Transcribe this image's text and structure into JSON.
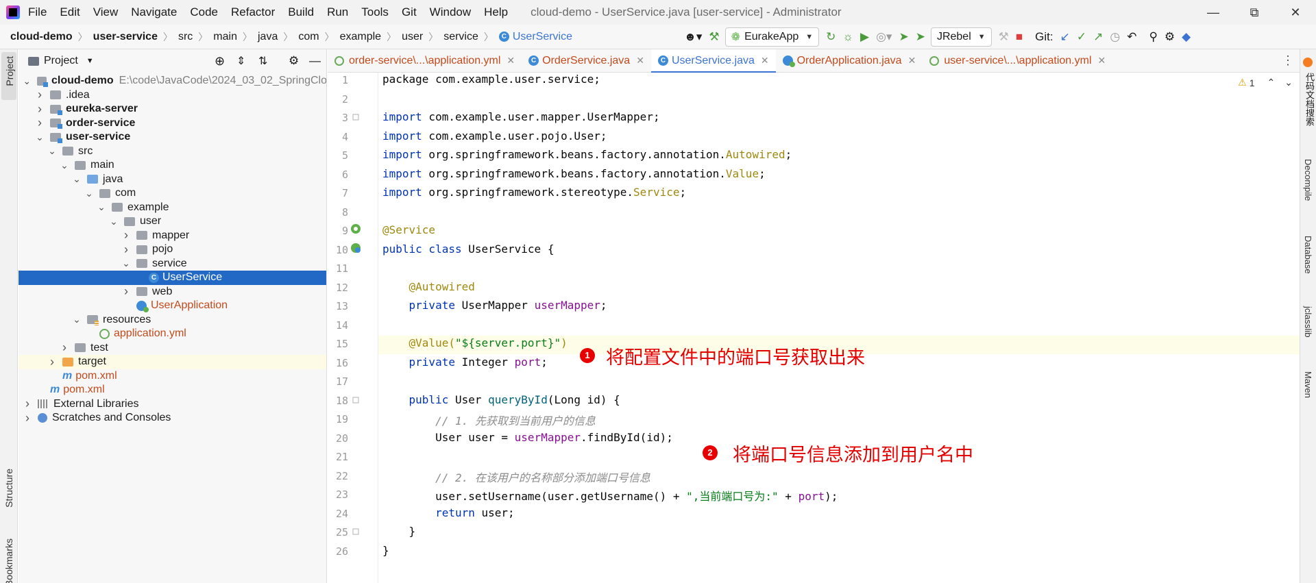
{
  "menubar": {
    "items": [
      "File",
      "Edit",
      "View",
      "Navigate",
      "Code",
      "Refactor",
      "Build",
      "Run",
      "Tools",
      "Git",
      "Window",
      "Help"
    ],
    "window_title": "cloud-demo - UserService.java [user-service] - Administrator"
  },
  "navbar": {
    "breadcrumbs": [
      "cloud-demo",
      "user-service",
      "src",
      "main",
      "java",
      "com",
      "example",
      "user",
      "service",
      "UserService"
    ],
    "run_config": "EurakeApp",
    "jrebel": "JRebel",
    "git_label": "Git:"
  },
  "project": {
    "title": "Project",
    "root_path": "E:\\code\\JavaCode\\2024_03_02_SpringClo",
    "tree": [
      {
        "label": "cloud-demo",
        "depth": 0,
        "expanded": true,
        "icon": "module",
        "bold": true,
        "extra": "root"
      },
      {
        "label": ".idea",
        "depth": 1,
        "expanded": false,
        "icon": "folder"
      },
      {
        "label": "eureka-server",
        "depth": 1,
        "expanded": false,
        "icon": "module",
        "bold": true
      },
      {
        "label": "order-service",
        "depth": 1,
        "expanded": false,
        "icon": "module",
        "bold": true
      },
      {
        "label": "user-service",
        "depth": 1,
        "expanded": true,
        "icon": "module",
        "bold": true
      },
      {
        "label": "src",
        "depth": 2,
        "expanded": true,
        "icon": "folder"
      },
      {
        "label": "main",
        "depth": 3,
        "expanded": true,
        "icon": "folder"
      },
      {
        "label": "java",
        "depth": 4,
        "expanded": true,
        "icon": "source"
      },
      {
        "label": "com",
        "depth": 5,
        "expanded": true,
        "icon": "folder"
      },
      {
        "label": "example",
        "depth": 6,
        "expanded": true,
        "icon": "folder"
      },
      {
        "label": "user",
        "depth": 7,
        "expanded": true,
        "icon": "folder"
      },
      {
        "label": "mapper",
        "depth": 8,
        "expanded": false,
        "icon": "folder"
      },
      {
        "label": "pojo",
        "depth": 8,
        "expanded": false,
        "icon": "folder"
      },
      {
        "label": "service",
        "depth": 8,
        "expanded": true,
        "icon": "folder"
      },
      {
        "label": "UserService",
        "depth": 9,
        "icon": "class",
        "selected": true
      },
      {
        "label": "web",
        "depth": 8,
        "expanded": false,
        "icon": "folder"
      },
      {
        "label": "UserApplication",
        "depth": 8,
        "icon": "app",
        "color": "#c44a1c"
      },
      {
        "label": "resources",
        "depth": 4,
        "expanded": true,
        "icon": "resources"
      },
      {
        "label": "application.yml",
        "depth": 5,
        "icon": "yml",
        "color": "#c44a1c"
      },
      {
        "label": "test",
        "depth": 3,
        "expanded": false,
        "icon": "folder"
      },
      {
        "label": "target",
        "depth": 2,
        "expanded": false,
        "icon": "target",
        "hl": true
      },
      {
        "label": "pom.xml",
        "depth": 2,
        "icon": "maven",
        "color": "#c44a1c"
      },
      {
        "label": "pom.xml",
        "depth": 1,
        "icon": "maven",
        "color": "#c44a1c"
      },
      {
        "label": "External Libraries",
        "depth": 0,
        "expanded": false,
        "icon": "lib"
      },
      {
        "label": "Scratches and Consoles",
        "depth": 0,
        "expanded": false,
        "icon": "scratch"
      }
    ]
  },
  "tabs": [
    {
      "label": "order-service\\...\\application.yml",
      "type": "yml",
      "color": "#c44a1c"
    },
    {
      "label": "OrderService.java",
      "type": "class",
      "color": "#c44a1c"
    },
    {
      "label": "UserService.java",
      "type": "class",
      "active": true,
      "color": "#3c74d6"
    },
    {
      "label": "OrderApplication.java",
      "type": "app",
      "color": "#c44a1c"
    },
    {
      "label": "user-service\\...\\application.yml",
      "type": "yml",
      "color": "#c44a1c"
    }
  ],
  "editor": {
    "warning_count": "1",
    "lines": [
      [
        [
          "package com.example.user.service;",
          ""
        ]
      ],
      [],
      [
        [
          "import",
          "kw"
        ],
        [
          " com.example.user.mapper.UserMapper;",
          ""
        ]
      ],
      [
        [
          "import",
          "kw"
        ],
        [
          " com.example.user.pojo.User;",
          ""
        ]
      ],
      [
        [
          "import",
          "kw"
        ],
        [
          " org.springframework.beans.factory.annotation.",
          ""
        ],
        [
          "Autowired",
          "ann"
        ],
        [
          ";",
          ""
        ]
      ],
      [
        [
          "import",
          "kw"
        ],
        [
          " org.springframework.beans.factory.annotation.",
          ""
        ],
        [
          "Value",
          "ann"
        ],
        [
          ";",
          ""
        ]
      ],
      [
        [
          "import",
          "kw"
        ],
        [
          " org.springframework.stereotype.",
          ""
        ],
        [
          "Service",
          "ann"
        ],
        [
          ";",
          ""
        ]
      ],
      [],
      [
        [
          "@Service",
          "ann"
        ]
      ],
      [
        [
          "public class",
          "kw"
        ],
        [
          " UserService {",
          ""
        ]
      ],
      [],
      [
        [
          "    ",
          ""
        ],
        [
          "@Autowired",
          "ann"
        ]
      ],
      [
        [
          "    ",
          ""
        ],
        [
          "private",
          "kw"
        ],
        [
          " UserMapper ",
          ""
        ],
        [
          "userMapper",
          "fld"
        ],
        [
          ";",
          ""
        ]
      ],
      [],
      [
        [
          "    ",
          ""
        ],
        [
          "@Value(",
          "ann"
        ],
        [
          "\"${server.port}\"",
          "str"
        ],
        [
          ")",
          "ann"
        ]
      ],
      [
        [
          "    ",
          ""
        ],
        [
          "private",
          "kw"
        ],
        [
          " Integer ",
          ""
        ],
        [
          "port",
          "fld"
        ],
        [
          ";",
          ""
        ]
      ],
      [],
      [
        [
          "    ",
          ""
        ],
        [
          "public",
          "kw"
        ],
        [
          " User ",
          ""
        ],
        [
          "queryById",
          "fn"
        ],
        [
          "(Long id) {",
          ""
        ]
      ],
      [
        [
          "        ",
          ""
        ],
        [
          "// 1. 先获取到当前用户的信息",
          "cmt"
        ]
      ],
      [
        [
          "        User user = ",
          ""
        ],
        [
          "userMapper",
          "fld"
        ],
        [
          ".findById(id);",
          ""
        ]
      ],
      [],
      [
        [
          "        ",
          ""
        ],
        [
          "// 2. 在该用户的名称部分添加端口号信息",
          "cmt"
        ]
      ],
      [
        [
          "        user.setUsername(user.getUsername() + ",
          ""
        ],
        [
          "\",当前端口号为:\"",
          "str"
        ],
        [
          " + ",
          ""
        ],
        [
          "port",
          "fld"
        ],
        [
          ");",
          ""
        ]
      ],
      [
        [
          "        ",
          ""
        ],
        [
          "return",
          "kw"
        ],
        [
          " user;",
          ""
        ]
      ],
      [
        [
          "    }",
          ""
        ]
      ],
      [
        [
          "}",
          ""
        ]
      ]
    ]
  },
  "annotations": [
    {
      "num": "1",
      "text": "将配置文件中的端口号获取出来"
    },
    {
      "num": "2",
      "text": "将端口号信息添加到用户名中"
    }
  ],
  "left_strip": {
    "project": "Project",
    "structure": "Structure",
    "bookmarks": "Bookmarks"
  },
  "right_strip": [
    "代码文档搜索",
    "Decompile",
    "Database",
    "jclasslib",
    "Maven"
  ]
}
